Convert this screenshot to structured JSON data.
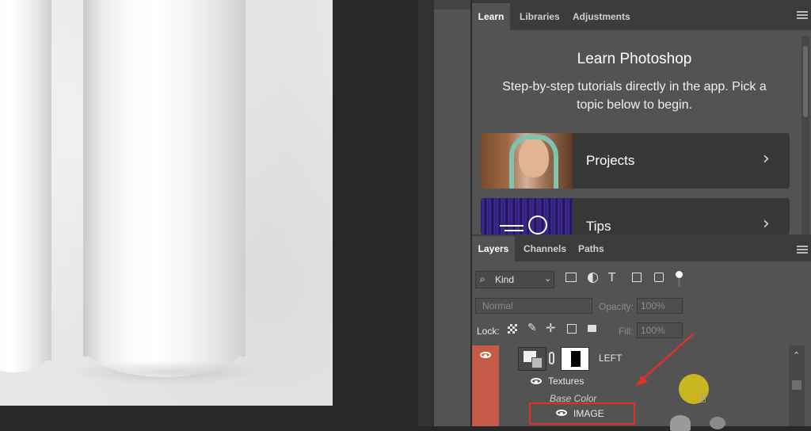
{
  "learn_panel": {
    "tabs": [
      "Learn",
      "Libraries",
      "Adjustments"
    ],
    "title": "Learn Photoshop",
    "description": "Step-by-step tutorials directly in the app. Pick a topic below to begin.",
    "cards": [
      {
        "label": "Projects",
        "icon": "chevron-right-icon"
      },
      {
        "label": "Tips",
        "icon": "chevron-right-icon"
      }
    ]
  },
  "layers_panel": {
    "tabs": [
      "Layers",
      "Channels",
      "Paths"
    ],
    "filter": {
      "label": "Kind"
    },
    "blend_mode": "Normal",
    "opacity": {
      "label": "Opacity:",
      "value": "100%"
    },
    "lock": {
      "label": "Lock:"
    },
    "fill": {
      "label": "Fill:",
      "value": "100%"
    },
    "layers": [
      {
        "name": "LEFT"
      },
      {
        "name": "Textures"
      },
      {
        "name": "Base Color"
      },
      {
        "name": "IMAGE"
      }
    ]
  },
  "colors": {
    "panel_bg": "#535353",
    "dark_bg": "#282828",
    "selected_layer": "#c65a48",
    "highlight_red": "#e0302a",
    "cursor_yellow": "#d7c21a"
  }
}
